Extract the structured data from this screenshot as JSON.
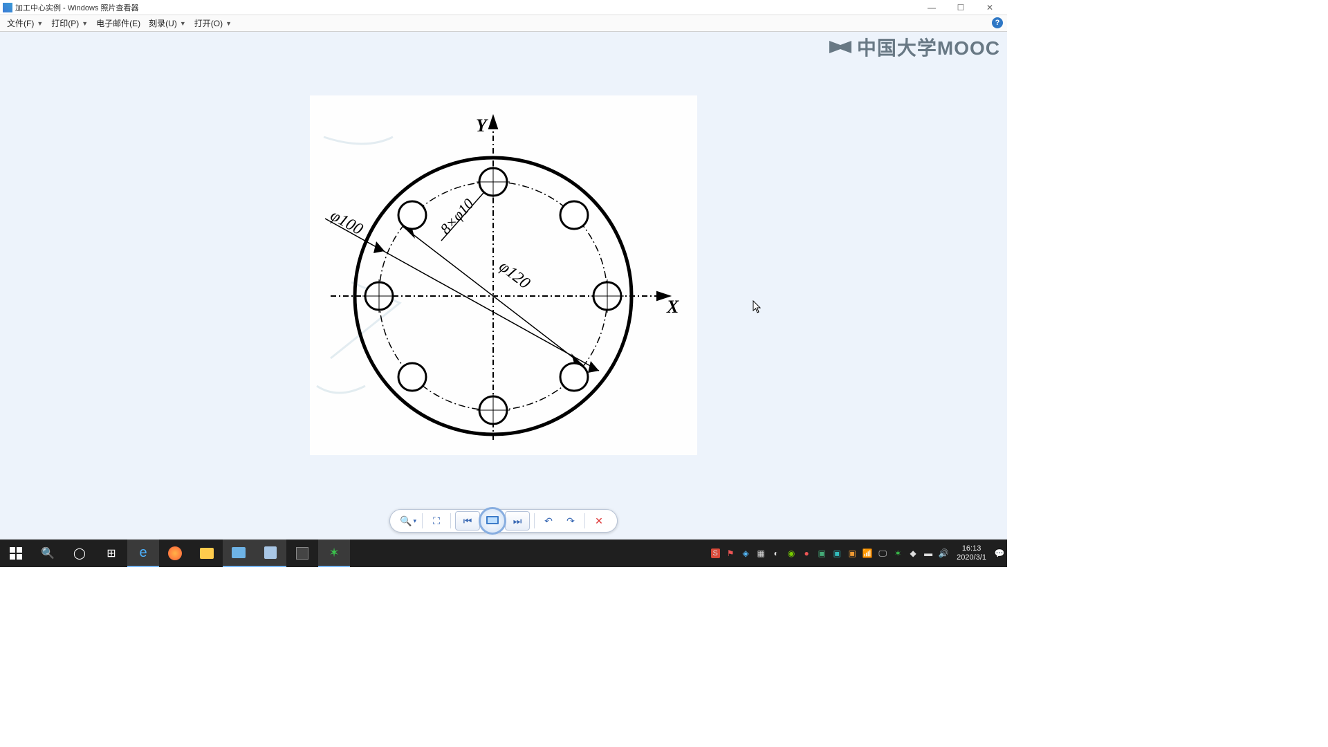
{
  "titlebar": {
    "title": "加工中心实例 - Windows 照片查看器"
  },
  "menubar": {
    "file": "文件(F)",
    "print": "打印(P)",
    "email": "电子邮件(E)",
    "burn": "刻录(U)",
    "open": "打开(O)"
  },
  "watermark": "中国大学MOOC",
  "diagram": {
    "y_label": "Y",
    "x_label": "X",
    "outer_dia": "φ100",
    "bolt_circle": "φ120",
    "holes": "8×φ10"
  },
  "tray": {
    "time": "16:13",
    "date": "2020/3/1"
  }
}
